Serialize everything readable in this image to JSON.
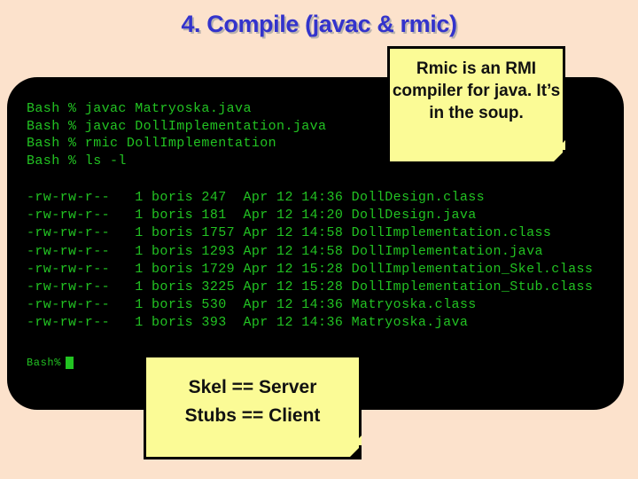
{
  "slide": {
    "title": "4. Compile (javac & rmic)",
    "background_color": "#FCE2CC",
    "title_color": "#3333CC"
  },
  "terminal": {
    "background_color": "#000000",
    "text_color": "#22C322",
    "commands": [
      "Bash % javac Matryoska.java",
      "Bash % javac DollImplementation.java",
      "Bash % rmic DollImplementation",
      "Bash % ls -l"
    ],
    "listing": [
      "-rw-rw-r--   1 boris 247  Apr 12 14:36 DollDesign.class",
      "-rw-rw-r--   1 boris 181  Apr 12 14:20 DollDesign.java",
      "-rw-rw-r--   1 boris 1757 Apr 12 14:58 DollImplementation.class",
      "-rw-rw-r--   1 boris 1293 Apr 12 14:58 DollImplementation.java",
      "-rw-rw-r--   1 boris 1729 Apr 12 15:28 DollImplementation_Skel.class",
      "-rw-rw-r--   1 boris 3225 Apr 12 15:28 DollImplementation_Stub.class",
      "-rw-rw-r--   1 boris 530  Apr 12 14:36 Matryoska.class",
      "-rw-rw-r--   1 boris 393  Apr 12 14:36 Matryoska.java"
    ],
    "prompt": "Bash%",
    "cursor": "block-cursor"
  },
  "notes": [
    {
      "id": "rmic-note",
      "text": "Rmic is an RMI compiler for java.  It’s in the soup.",
      "background_color": "#FBFB96",
      "border_color": "#000000"
    },
    {
      "id": "skel-note",
      "text": "Skel == Server\nStubs == Client",
      "background_color": "#FBFB96",
      "border_color": "#000000"
    }
  ]
}
